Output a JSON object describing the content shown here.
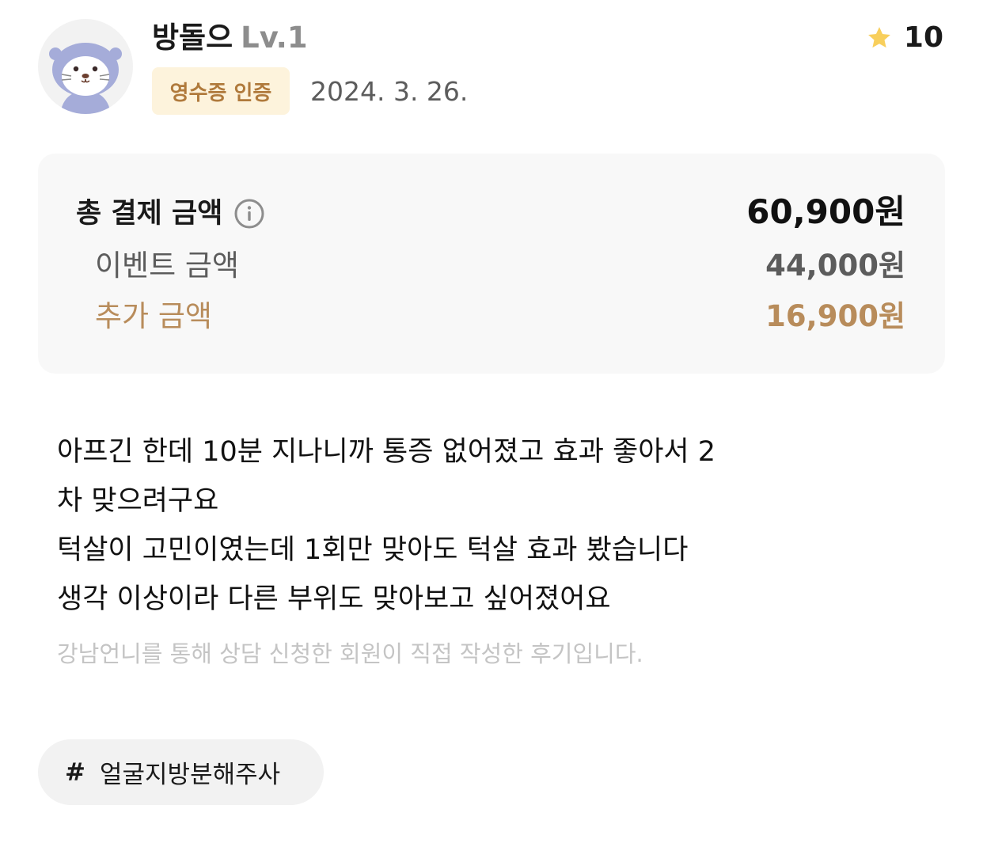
{
  "user": {
    "avatar_icon": "otter-avatar-icon",
    "name": "방돌으",
    "level": "Lv.1"
  },
  "rating": {
    "icon": "star-icon",
    "value": "10",
    "star_color": "#f8cf5c"
  },
  "verification_badge": "영수증 인증",
  "date": "2024. 3. 26.",
  "price": {
    "total_label": "총 결제 금액",
    "info_icon": "info-icon",
    "total_value": "60,900원",
    "event_label": "이벤트 금액",
    "event_value": "44,000원",
    "extra_label": "추가 금액",
    "extra_value": "16,900원",
    "accent_color": "#b88c5b"
  },
  "review": {
    "lines": [
      "아프긴 한데 10분 지나니까 통증 없어졌고 효과 좋아서 2",
      "차 맞으려구요",
      "턱살이 고민이였는데 1회만 맞아도 턱살 효과 봤습니다",
      "생각 이상이라 다른 부위도 맞아보고 싶어졌어요"
    ],
    "note": "강남언니를 통해 상담 신청한 회원이 직접 작성한 후기입니다."
  },
  "hashtag": {
    "symbol": "#",
    "label": "얼굴지방분해주사"
  }
}
